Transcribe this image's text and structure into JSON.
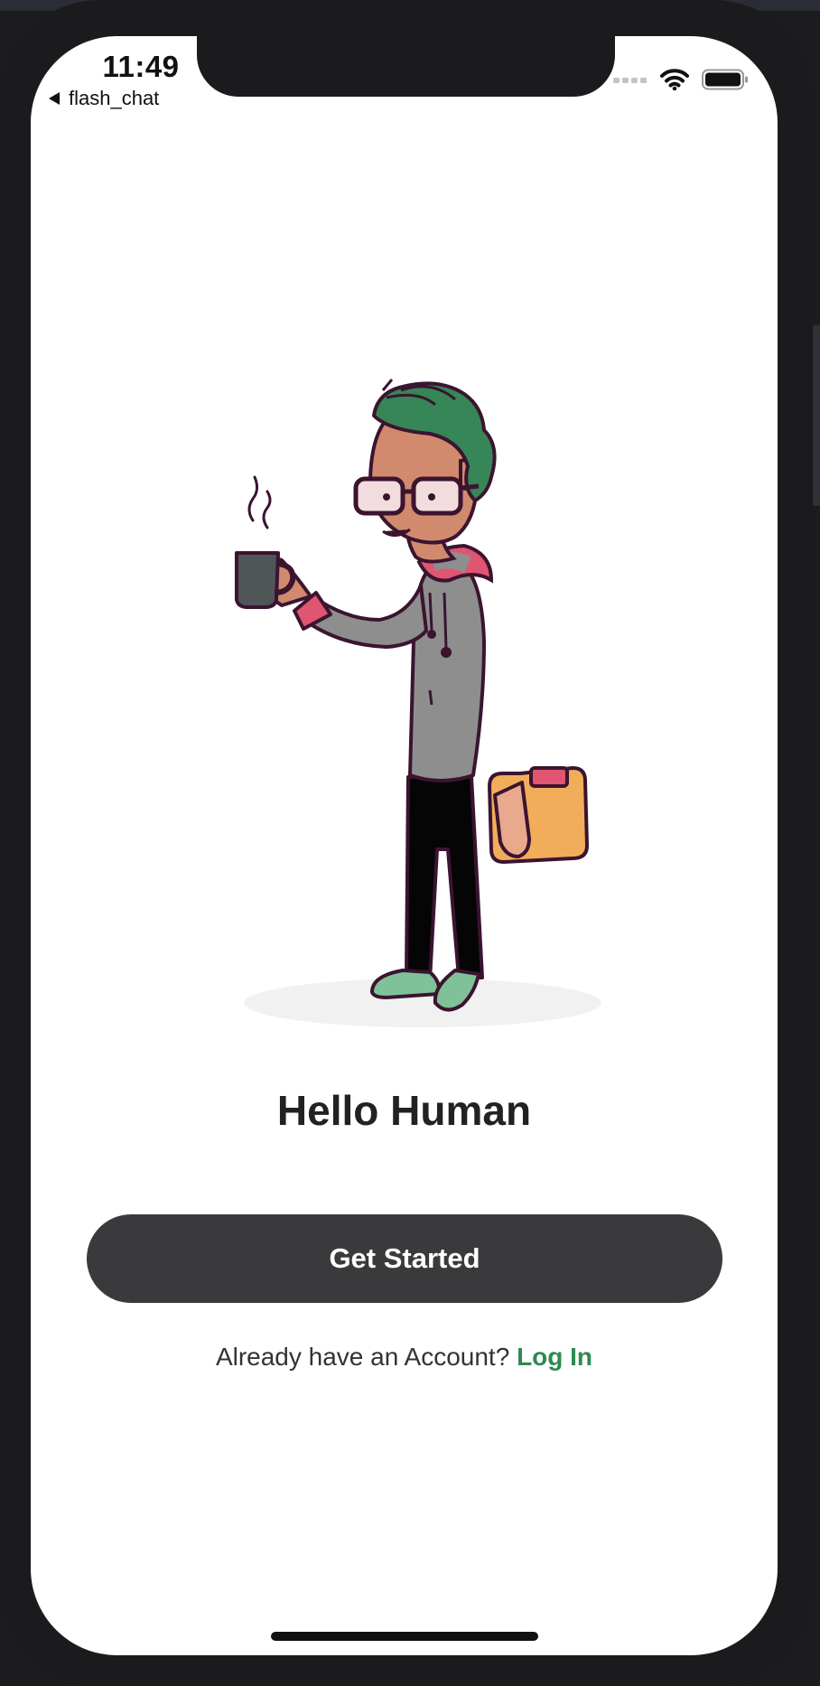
{
  "status_bar": {
    "time": "11:49",
    "back_app": "flash_chat",
    "icons": [
      "signal-icon",
      "wifi-icon",
      "battery-icon"
    ]
  },
  "welcome": {
    "illustration": "person-holding-coffee-illustration",
    "title": "Hello Human",
    "cta_label": "Get Started",
    "login_prompt": "Already have an Account?",
    "login_link": "Log In"
  },
  "colors": {
    "accent_green": "#2e8b4f",
    "button_bg": "#3a3a3c",
    "title_text": "#222222"
  }
}
